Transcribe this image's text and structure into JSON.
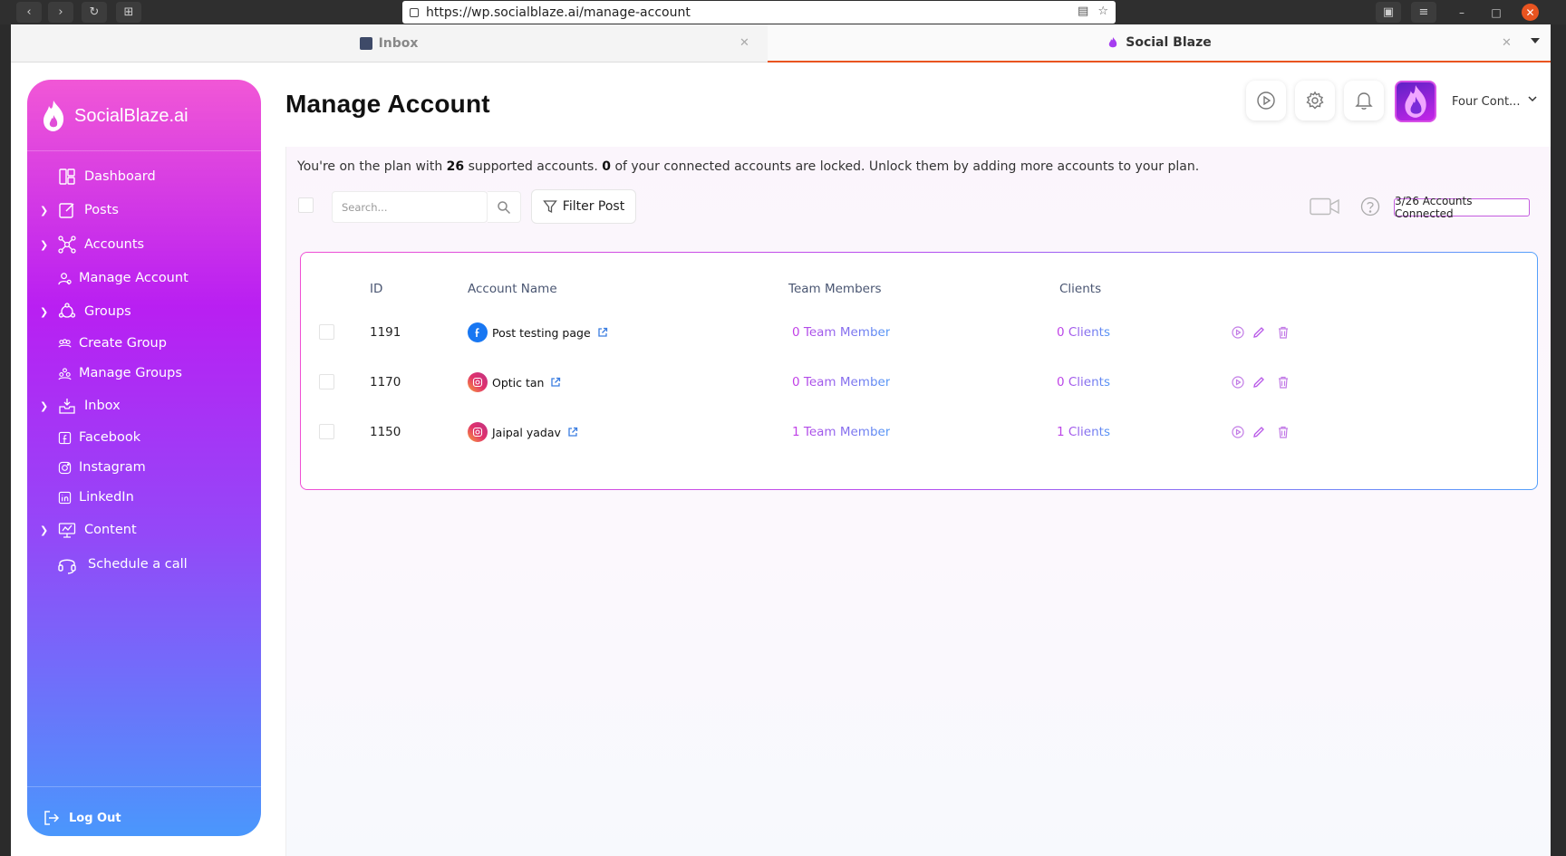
{
  "browser": {
    "url": "https://wp.socialblaze.ai/manage-account",
    "tabs": [
      {
        "label": "Inbox"
      },
      {
        "label": "Social Blaze"
      }
    ]
  },
  "sidebar": {
    "brand": "SocialBlaze.ai",
    "items": [
      {
        "label": "Dashboard",
        "icon": "dashboard-icon",
        "expandable": false
      },
      {
        "label": "Posts",
        "icon": "posts-icon",
        "expandable": true
      },
      {
        "label": "Accounts",
        "icon": "accounts-icon",
        "expandable": true
      },
      {
        "label": "Manage Account",
        "icon": "manage-account-icon",
        "expandable": false
      },
      {
        "label": "Groups",
        "icon": "groups-icon",
        "expandable": true
      },
      {
        "label": "Create Group",
        "icon": "create-group-icon",
        "expandable": false
      },
      {
        "label": "Manage Groups",
        "icon": "manage-groups-icon",
        "expandable": false
      },
      {
        "label": "Inbox",
        "icon": "inbox-icon",
        "expandable": true
      },
      {
        "label": "Facebook",
        "icon": "facebook-icon",
        "expandable": false
      },
      {
        "label": "Instagram",
        "icon": "instagram-icon",
        "expandable": false
      },
      {
        "label": "LinkedIn",
        "icon": "linkedin-icon",
        "expandable": false
      },
      {
        "label": "Content",
        "icon": "content-icon",
        "expandable": true
      },
      {
        "label": "Schedule a call",
        "icon": "headset-icon",
        "expandable": false
      }
    ],
    "logout": "Log Out"
  },
  "header": {
    "title": "Manage Account",
    "org_name": "Four Cont..."
  },
  "plan": {
    "text_1": "You're on the plan with ",
    "supported": "26",
    "text_2": " supported accounts. ",
    "locked": "0",
    "text_3": " of your connected accounts are locked. Unlock them by adding more accounts to your plan."
  },
  "toolbar": {
    "search_placeholder": "Search...",
    "filter_label": "Filter Post",
    "accounts_connected": "3/26 Accounts Connected"
  },
  "table": {
    "headers": {
      "id": "ID",
      "account_name": "Account Name",
      "team_members": "Team Members",
      "clients": "Clients"
    },
    "rows": [
      {
        "id": "1191",
        "name": "Post testing page",
        "platform": "facebook",
        "team": "0 Team Member",
        "clients": "0 Clients"
      },
      {
        "id": "1170",
        "name": "Optic tan",
        "platform": "instagram",
        "team": "0 Team Member",
        "clients": "0 Clients"
      },
      {
        "id": "1150",
        "name": "Jaipal yadav",
        "platform": "instagram",
        "team": "1 Team Member",
        "clients": "1 Clients"
      }
    ]
  },
  "colors": {
    "accent_pink": "#f157d6",
    "accent_purple": "#b91ff2",
    "accent_blue": "#4a97fc",
    "tab_active": "#e95420"
  }
}
